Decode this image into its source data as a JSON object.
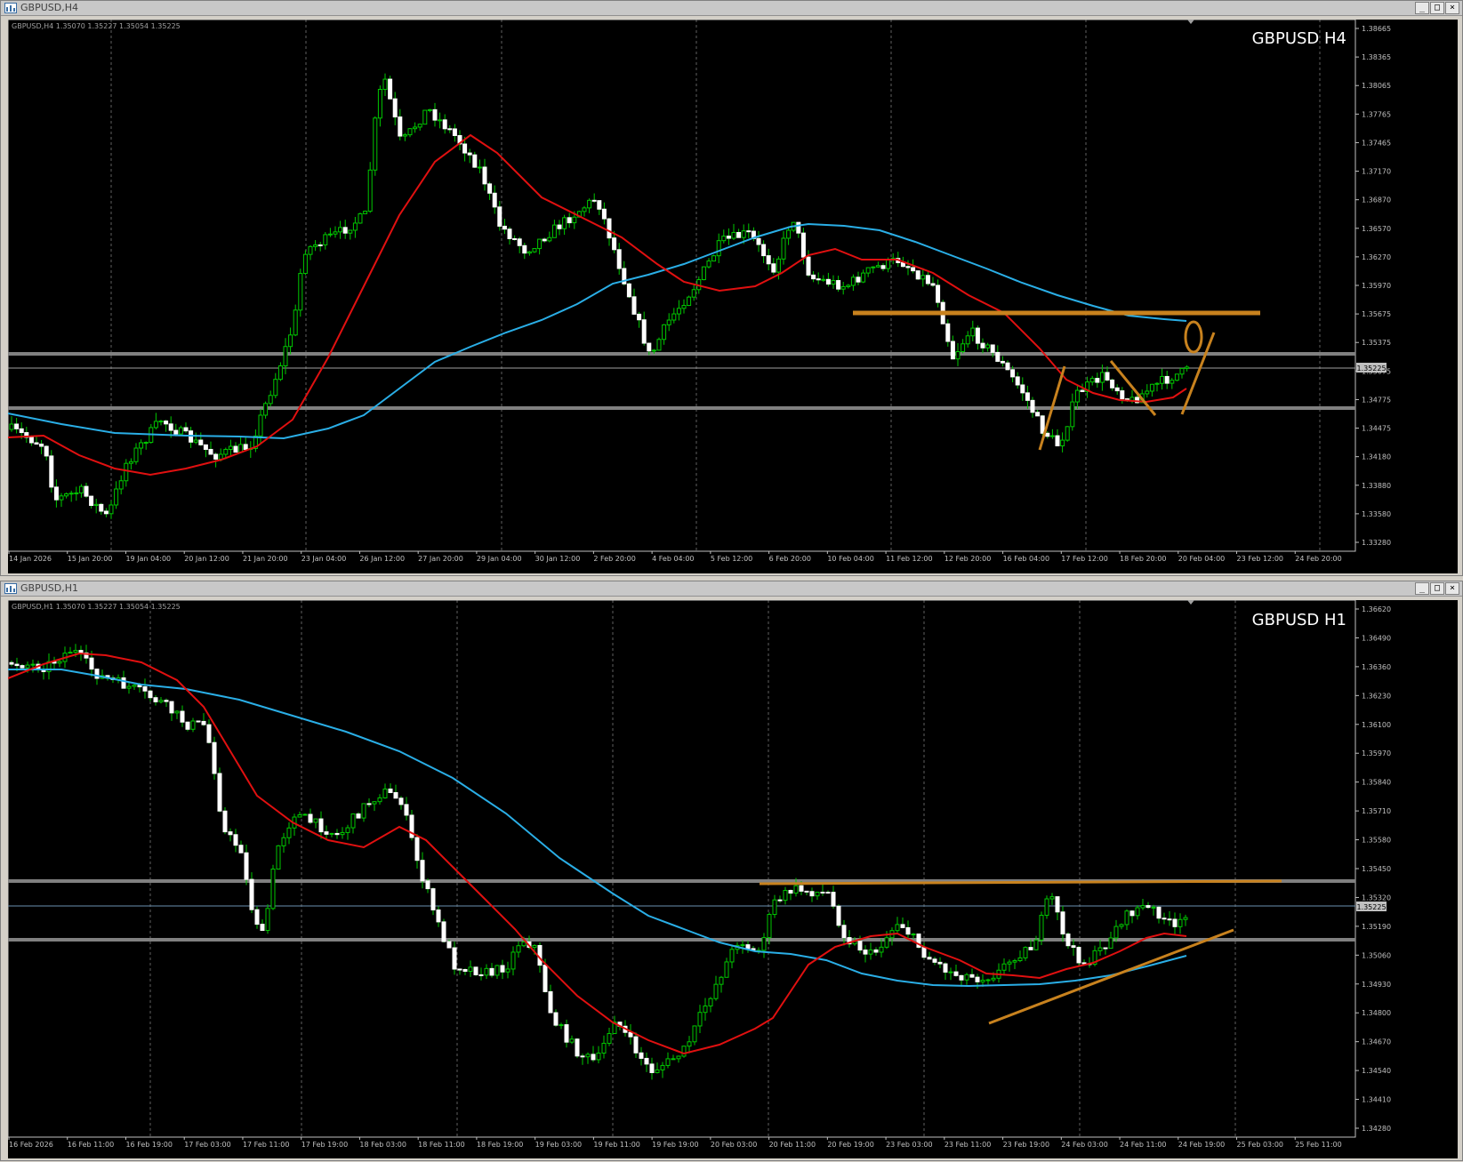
{
  "windows": [
    {
      "title": "GBPUSD,H4",
      "info": "GBPUSD,H4  1.35070 1.35227 1.35054 1.35225",
      "label": "GBPUSD H4",
      "current_price": "1.35225",
      "price_ticks": [
        "1.38665",
        "1.38365",
        "1.38065",
        "1.37765",
        "1.37465",
        "1.37170",
        "1.36870",
        "1.36570",
        "1.36270",
        "1.35970",
        "1.35675",
        "1.35375",
        "1.35075",
        "1.34775",
        "1.34475",
        "1.34180",
        "1.33880",
        "1.33580",
        "1.33280"
      ],
      "time_ticks": [
        "14 Jan 2026",
        "15 Jan 20:00",
        "19 Jan 04:00",
        "20 Jan 12:00",
        "21 Jan 20:00",
        "23 Jan 04:00",
        "26 Jan 12:00",
        "27 Jan 20:00",
        "29 Jan 04:00",
        "30 Jan 12:00",
        "2 Feb 20:00",
        "4 Feb 04:00",
        "5 Feb 12:00",
        "6 Feb 20:00",
        "10 Feb 04:00",
        "11 Feb 12:00",
        "12 Feb 20:00",
        "16 Feb 04:00",
        "17 Feb 12:00",
        "18 Feb 20:00",
        "20 Feb 04:00",
        "23 Feb 12:00",
        "24 Feb 20:00"
      ]
    },
    {
      "title": "GBPUSD,H1",
      "info": "GBPUSD,H1  1.35070 1.35227 1.35054 1.35225",
      "label": "GBPUSD H1",
      "current_price": "1.35225",
      "price_ticks": [
        "1.36620",
        "1.36490",
        "1.36360",
        "1.36230",
        "1.36100",
        "1.35970",
        "1.35840",
        "1.35710",
        "1.35580",
        "1.35450",
        "1.35320",
        "1.35190",
        "1.35060",
        "1.34930",
        "1.34800",
        "1.34670",
        "1.34540",
        "1.34410",
        "1.34280"
      ],
      "time_ticks": [
        "16 Feb 2026",
        "16 Feb 11:00",
        "16 Feb 19:00",
        "17 Feb 03:00",
        "17 Feb 11:00",
        "17 Feb 19:00",
        "18 Feb 03:00",
        "18 Feb 11:00",
        "18 Feb 19:00",
        "19 Feb 03:00",
        "19 Feb 11:00",
        "19 Feb 19:00",
        "20 Feb 03:00",
        "20 Feb 11:00",
        "20 Feb 19:00",
        "23 Feb 03:00",
        "23 Feb 11:00",
        "23 Feb 19:00",
        "24 Feb 03:00",
        "24 Feb 11:00",
        "24 Feb 19:00",
        "25 Feb 03:00",
        "25 Feb 11:00"
      ]
    }
  ],
  "colors": {
    "bull": "#00c800",
    "ma_fast": "#e01010",
    "ma_slow": "#2aaee6",
    "level": "#808080",
    "annotation": "#c8821e"
  }
}
